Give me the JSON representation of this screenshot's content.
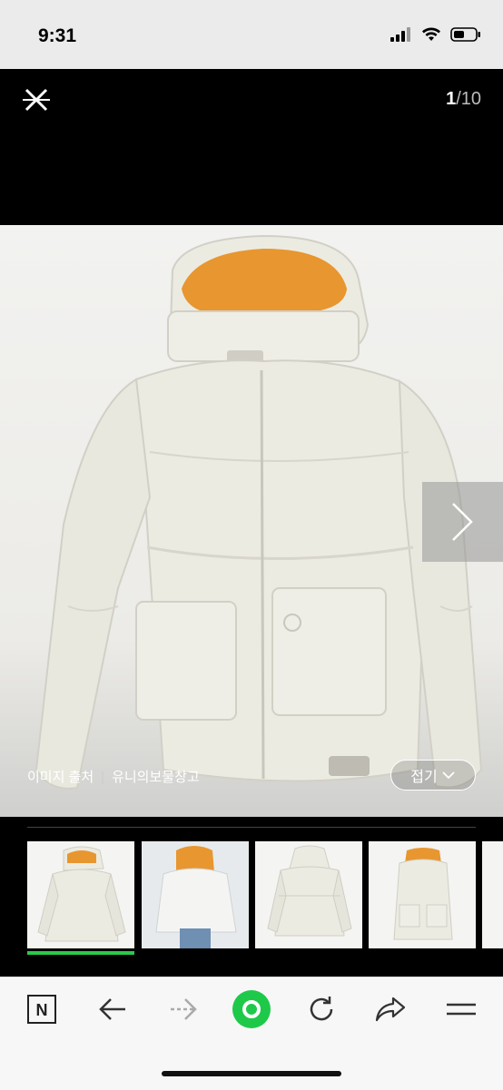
{
  "status_bar": {
    "time": "9:31"
  },
  "viewer": {
    "counter_current": "1",
    "counter_total": "/10",
    "source_label": "이미지 출처",
    "source_name": "유니의보물창고",
    "fold_label": "접기"
  },
  "thumbnails": [
    {
      "name": "thumbnail-1",
      "active": true
    },
    {
      "name": "thumbnail-2",
      "active": false
    },
    {
      "name": "thumbnail-3",
      "active": false
    },
    {
      "name": "thumbnail-4",
      "active": false
    },
    {
      "name": "thumbnail-5",
      "active": false
    }
  ],
  "browser_toolbar": {
    "icons": [
      "naver-home-icon",
      "back-arrow-icon",
      "forward-arrow-icon",
      "green-home-icon",
      "refresh-icon",
      "share-icon",
      "menu-icon"
    ]
  },
  "colors": {
    "accent_green": "#2bc94a",
    "jacket": "#ecebe2",
    "lining": "#e8962f"
  }
}
